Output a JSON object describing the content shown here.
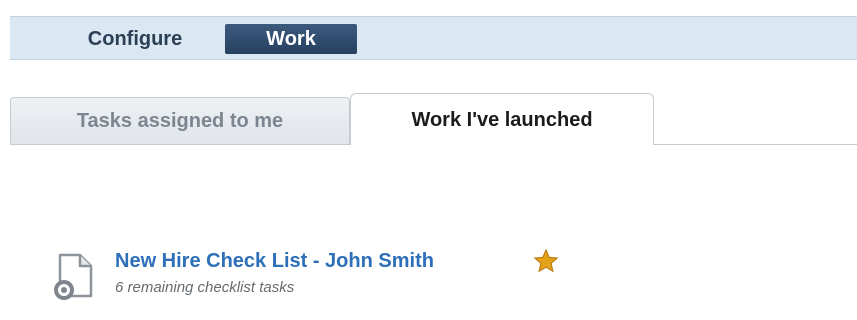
{
  "nav": {
    "items": [
      {
        "label": "Configure",
        "active": false
      },
      {
        "label": "Work",
        "active": true
      }
    ]
  },
  "tabs": [
    {
      "label": "Tasks assigned to me",
      "active": false
    },
    {
      "label": "Work I've launched",
      "active": true
    }
  ],
  "work_items": [
    {
      "title": "New Hire Check List - John Smith",
      "subtitle": "6 remaining checklist tasks",
      "icon": "document-gear-icon",
      "starred": true
    }
  ],
  "colors": {
    "nav_background": "#dbe7f2",
    "nav_active": "#26405f",
    "link": "#2d6fb8",
    "star": "#e3a21a"
  }
}
